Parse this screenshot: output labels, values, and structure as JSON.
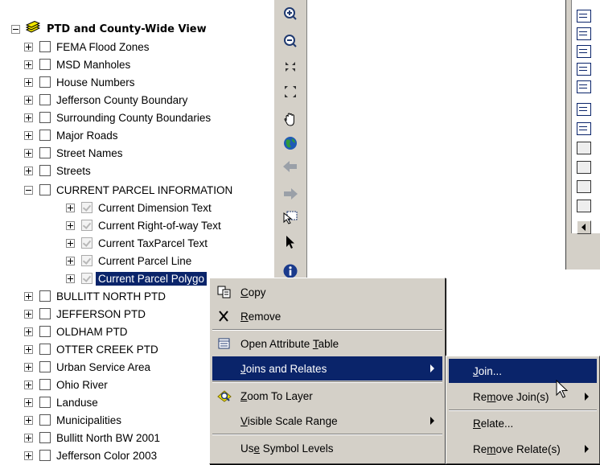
{
  "toc": {
    "group_label": "PTD and County-Wide View",
    "layers": [
      {
        "label": "FEMA Flood Zones"
      },
      {
        "label": "MSD Manholes"
      },
      {
        "label": "House Numbers"
      },
      {
        "label": "Jefferson County Boundary"
      },
      {
        "label": "Surrounding County Boundaries"
      },
      {
        "label": "Major Roads"
      },
      {
        "label": "Street Names"
      },
      {
        "label": "Streets"
      },
      {
        "label": "CURRENT PARCEL INFORMATION"
      },
      {
        "label": "Current Dimension Text"
      },
      {
        "label": "Current Right-of-way Text"
      },
      {
        "label": "Current TaxParcel Text"
      },
      {
        "label": "Current Parcel Line"
      },
      {
        "label": "Current Parcel Polygo"
      },
      {
        "label": "BULLITT NORTH PTD"
      },
      {
        "label": "JEFFERSON PTD"
      },
      {
        "label": "OLDHAM PTD"
      },
      {
        "label": "OTTER CREEK PTD"
      },
      {
        "label": "Urban Service Area"
      },
      {
        "label": "Ohio River"
      },
      {
        "label": "Landuse"
      },
      {
        "label": "Municipalities"
      },
      {
        "label": "Bullitt North BW 2001"
      },
      {
        "label": "Jefferson Color 2003"
      }
    ]
  },
  "toolbar_icons": [
    "zoom-in-icon",
    "zoom-out-icon",
    "fixed-zoom-in-icon",
    "fixed-zoom-out-icon",
    "pan-icon",
    "full-extent-icon",
    "back-icon",
    "forward-icon",
    "select-features-icon",
    "select-elements-icon",
    "identify-icon"
  ],
  "context_menu": {
    "items": [
      {
        "pre": "",
        "u": "C",
        "post": "opy",
        "icon": "copy-icon"
      },
      {
        "pre": "",
        "u": "R",
        "post": "emove",
        "icon": "remove-icon"
      },
      {
        "pre": "Open Attribute ",
        "u": "T",
        "post": "able",
        "icon": "table-icon"
      },
      {
        "pre": "",
        "u": "J",
        "post": "oins and Relates",
        "icon": ""
      },
      {
        "pre": "",
        "u": "Z",
        "post": "oom To Layer",
        "icon": "zoom-to-layer-icon"
      },
      {
        "pre": "",
        "u": "V",
        "post": "isible Scale Range",
        "icon": ""
      },
      {
        "pre": "Us",
        "u": "e",
        "post": " Symbol Levels",
        "icon": ""
      }
    ]
  },
  "submenu": {
    "items": [
      {
        "pre": "",
        "u": "J",
        "post": "oin..."
      },
      {
        "pre": "Re",
        "u": "m",
        "post": "ove Join(s)"
      },
      {
        "pre": "",
        "u": "R",
        "post": "elate..."
      },
      {
        "pre": "Re",
        "u": "m",
        "post": "ove Relate(s)"
      }
    ]
  },
  "colors": {
    "highlight": "#0a246a",
    "face": "#d4d0c8"
  }
}
